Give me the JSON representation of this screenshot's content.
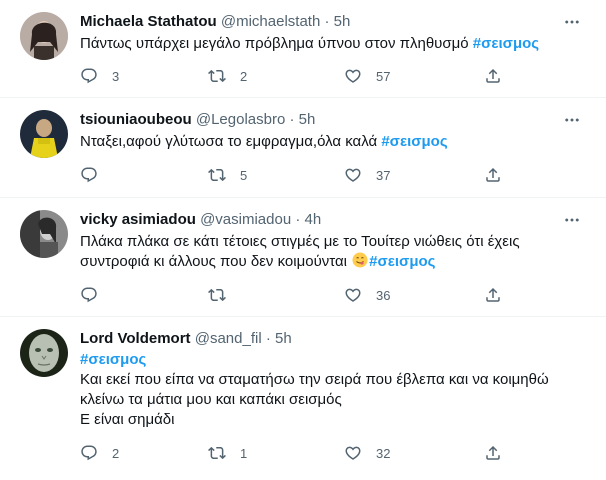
{
  "tweets": [
    {
      "name": "Michaela Stathatou",
      "handle": "@michaelstath",
      "separator": "·",
      "time": "5h",
      "text_1": "Πάντως υπάρχει μεγάλο πρόβλημα ύπνου στον πληθυσμό ",
      "hashtag": "#σεισμος",
      "replies": "3",
      "retweets": "2",
      "likes": "57"
    },
    {
      "name": "tsiouniaoubeou",
      "handle": "@Legolasbro",
      "separator": "·",
      "time": "5h",
      "text_1": "Νταξει,αφού γλύτωσα το εμφραγμα,όλα καλά ",
      "hashtag": "#σεισμος",
      "replies": "",
      "retweets": "5",
      "likes": "37"
    },
    {
      "name": "vicky asimiadou",
      "handle": "@vasimiadou",
      "separator": "·",
      "time": "4h",
      "line_1": "Πλάκα πλάκα σε κάτι τέτοιες στιγμές με το Τουίτερ νιώθεις ότι έχεις",
      "line_2": "συντροφιά κι άλλους που δεν κοιμούνται ",
      "emoji": "face-savoring-food-emoji",
      "hashtag": "#σεισμος",
      "replies": "",
      "retweets": "",
      "likes": "36"
    },
    {
      "name": "Lord Voldemort",
      "handle": "@sand_fil",
      "separator": "·",
      "time": "5h",
      "hashtag": "#σεισμος",
      "line_1": "Και εκεί που είπα να σταματήσω την σειρά που έβλεπα και να κοιμηθώ",
      "line_2": "κλείνω τα μάτια μου και καπάκι σεισμός",
      "line_3": "Ε είναι σημάδι",
      "replies": "2",
      "retweets": "1",
      "likes": "32"
    }
  ],
  "icons": {
    "reply": "reply-icon",
    "retweet": "retweet-icon",
    "like": "like-icon",
    "share": "share-icon",
    "more": "more-icon"
  },
  "colors": {
    "hashtag": "#1d9bf0",
    "secondary_text": "#536471",
    "divider": "#eff3f4"
  }
}
